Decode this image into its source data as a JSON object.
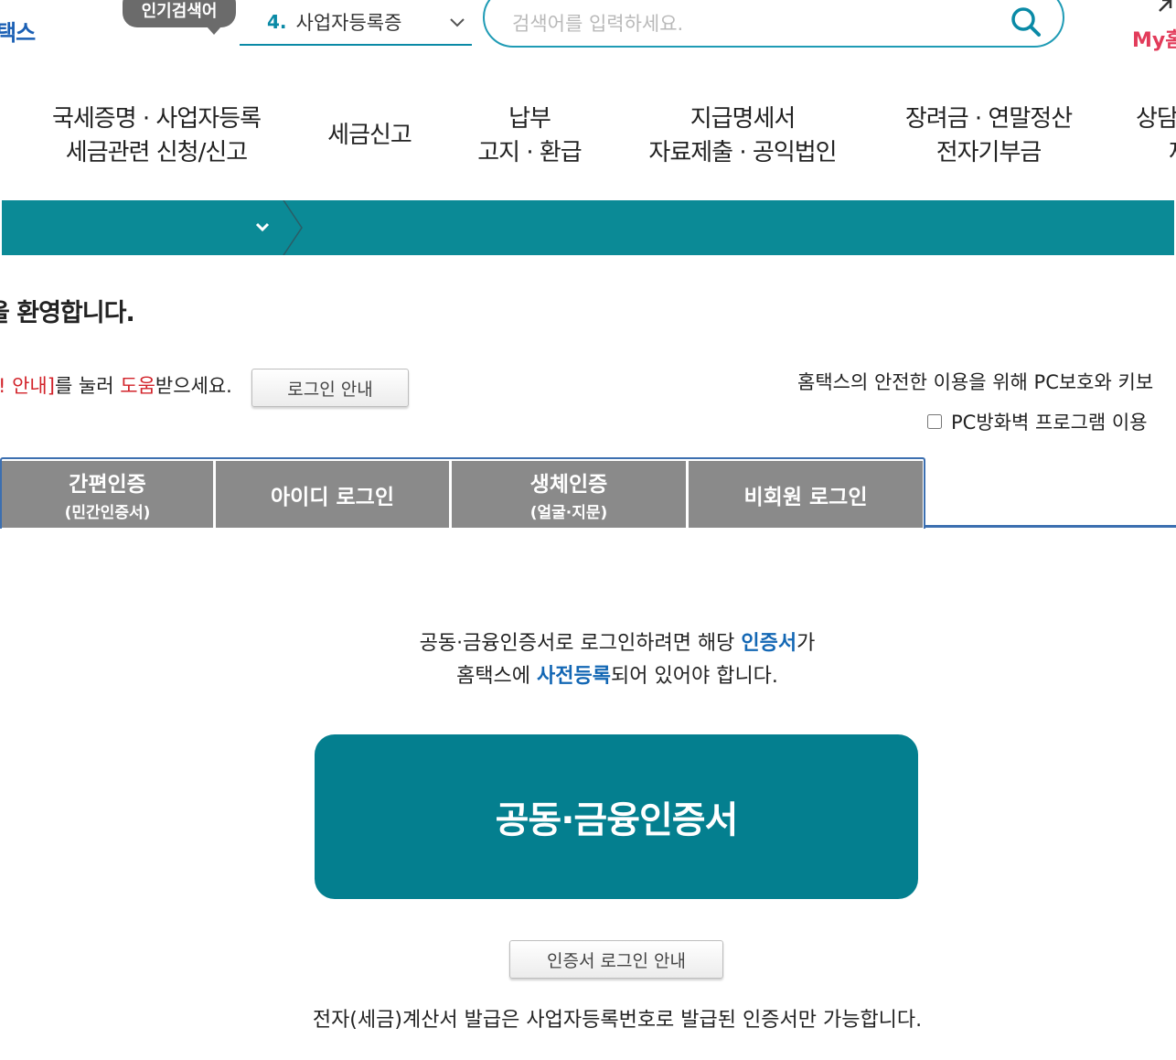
{
  "header": {
    "logo_fragment": "택스",
    "popular_badge": "인기검색어",
    "popular_rank": {
      "number": "4.",
      "text": "사업자등록증"
    },
    "search": {
      "placeholder": "검색어를 입력하세요."
    },
    "my_home_fragment": "My홈"
  },
  "nav": {
    "items": [
      {
        "line1": "국세증명 · 사업자등록",
        "line2": "세금관련 신청/신고"
      },
      {
        "line1": "세금신고",
        "line2": ""
      },
      {
        "line1": "납부",
        "line2": "고지 · 환급"
      },
      {
        "line1": "지급명세서",
        "line2": "자료제출 · 공익법인"
      },
      {
        "line1": "장려금 · 연말정산",
        "line2": "전자기부금"
      },
      {
        "line1": "상담",
        "line2": "제"
      }
    ]
  },
  "welcome": "을 환영합니다.",
  "help": {
    "part1": "! 안내]",
    "part2": "를 눌러 ",
    "part3": "도움",
    "part4": "받으세요.",
    "button": "로그인 안내"
  },
  "pc_notice": "홈택스의 안전한 이용을 위해 PC보호와 키보",
  "firewall_label": "PC방화벽 프로그램 이용",
  "tabs": [
    {
      "label": "간편인증",
      "sub": "(민간인증서)"
    },
    {
      "label": "아이디 로그인",
      "sub": ""
    },
    {
      "label": "생체인증",
      "sub": "(얼굴·지문)"
    },
    {
      "label": "비회원 로그인",
      "sub": ""
    }
  ],
  "cert": {
    "desc1_a": "공동·금융인증서로 로그인하려면 해당 ",
    "desc1_b": "인증서",
    "desc1_c": "가",
    "desc2_a": "홈택스에 ",
    "desc2_b": "사전등록",
    "desc2_c": "되어 있어야 합니다.",
    "button": "공동·금융인증서",
    "guide_button": "인증서 로그인 안내",
    "note": "전자(세금)계산서 발급은 사업자등록번호로 발급된 인증서만 가능합니다."
  },
  "colors": {
    "teal_bar": "#0b8a96",
    "cert_button": "#047f8f",
    "highlight_red": "#d2232a",
    "highlight_blue": "#1367b4",
    "tab_gray": "#8a8a8a"
  }
}
